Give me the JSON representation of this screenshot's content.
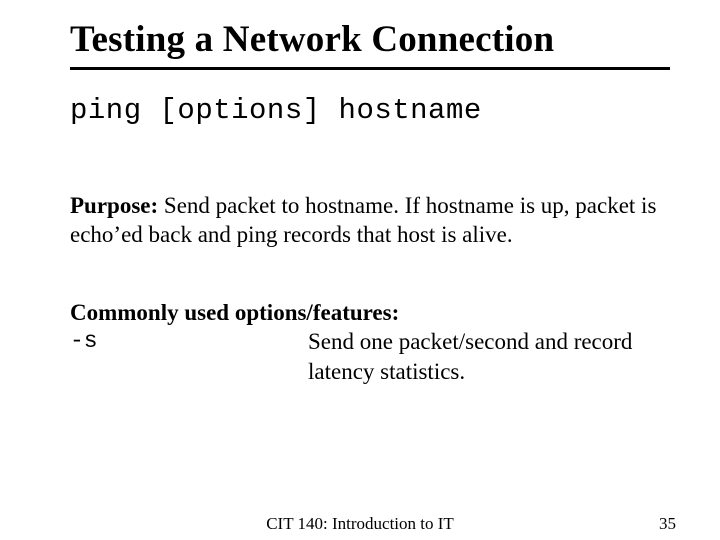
{
  "title": "Testing a Network Connection",
  "syntax": "ping [options] hostname",
  "purpose": {
    "label": "Purpose:",
    "text": " Send packet to hostname.  If hostname is up, packet is echo’ed back and ping records that host is alive."
  },
  "options": {
    "heading": "Commonly used options/features:",
    "items": [
      {
        "flag": "-s",
        "desc": "Send one packet/second and record latency statistics."
      }
    ]
  },
  "footer": {
    "course": "CIT 140: Introduction to IT",
    "page": "35"
  }
}
